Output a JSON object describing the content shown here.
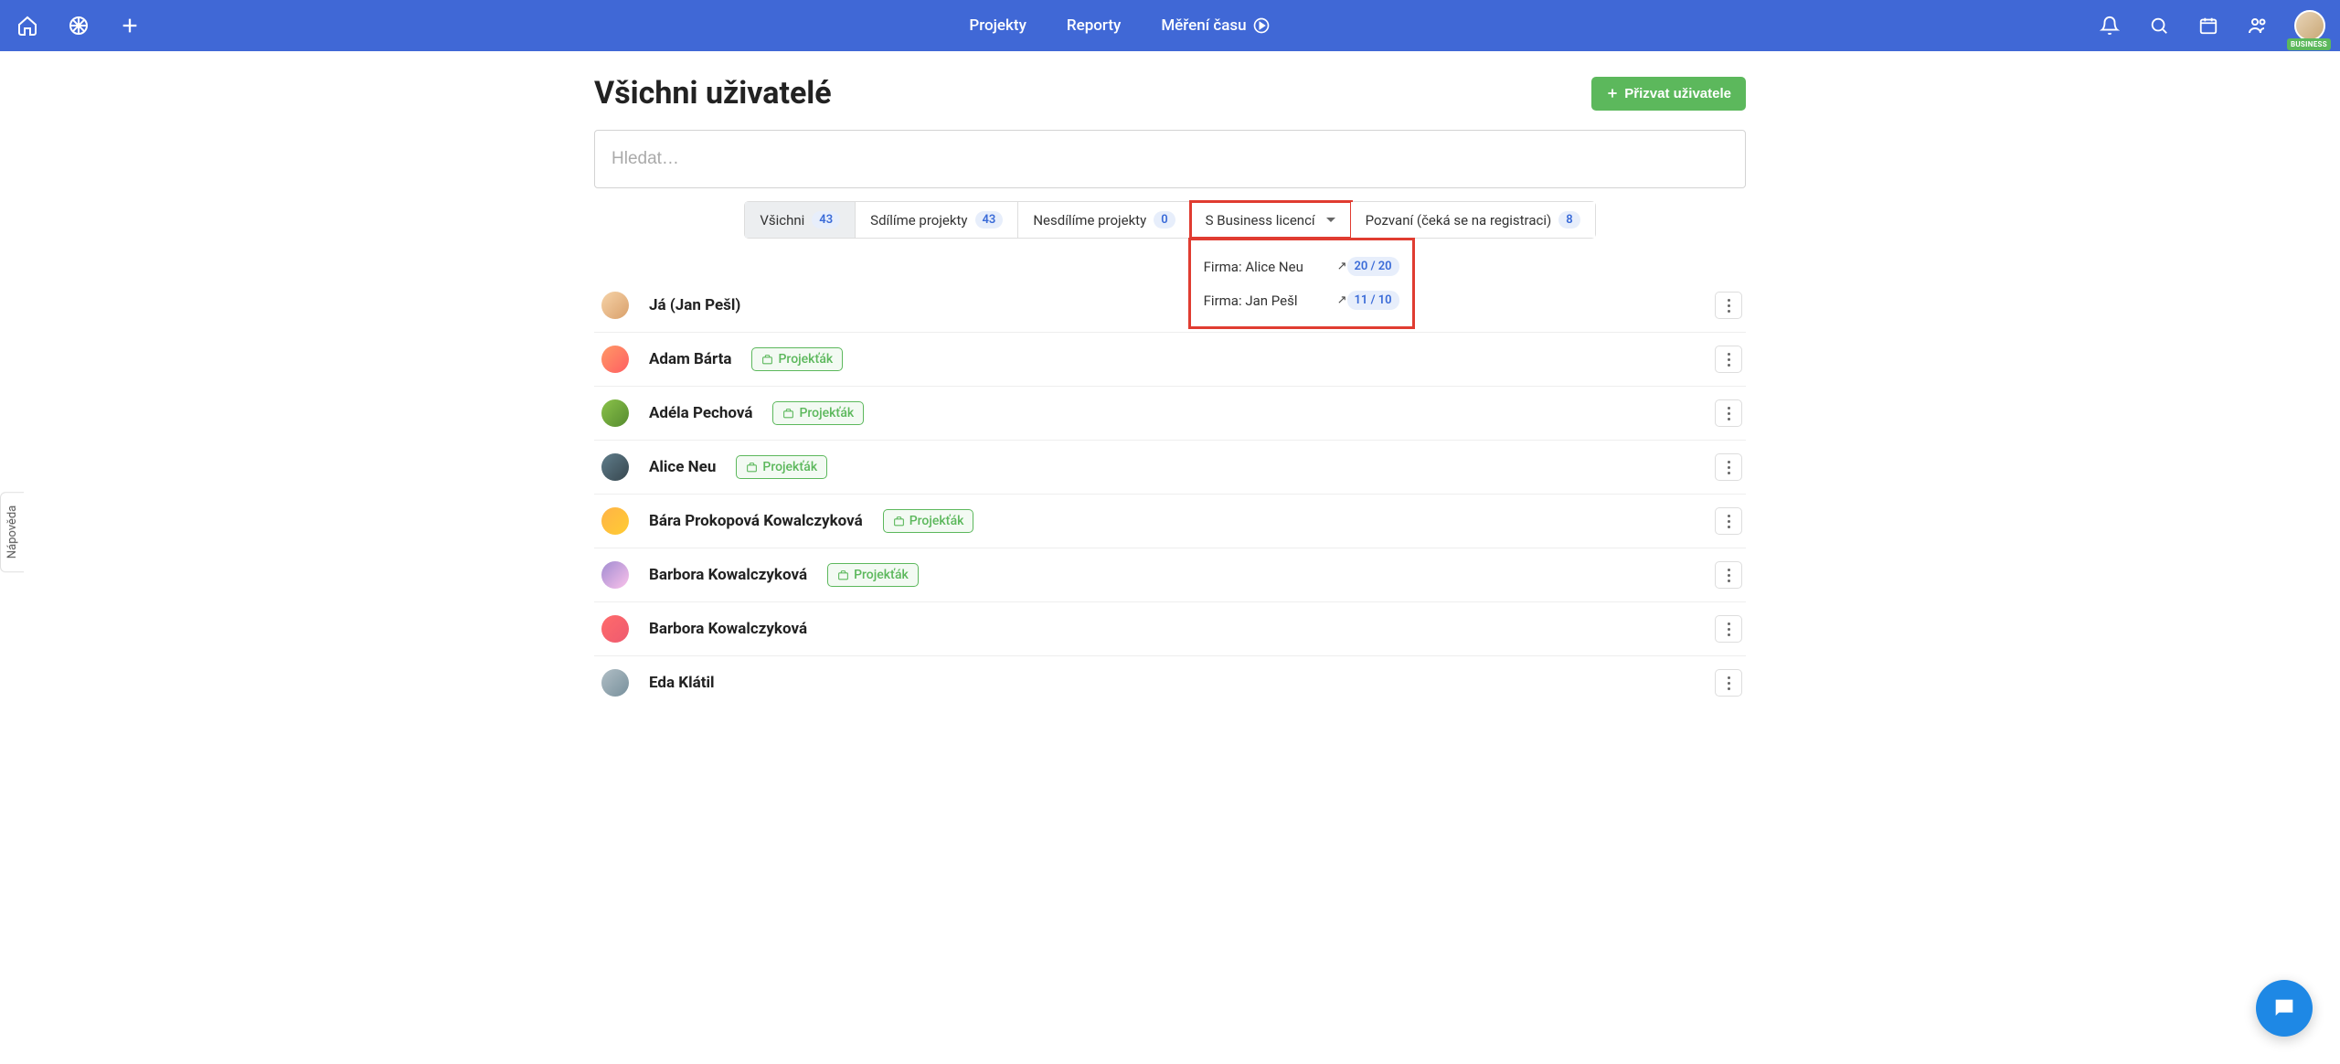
{
  "topbar": {
    "nav": {
      "projects": "Projekty",
      "reports": "Reporty",
      "timetracking": "Měření času"
    },
    "business_badge": "BUSINESS"
  },
  "help_tab": "Nápověda",
  "page": {
    "title": "Všichni uživatelé",
    "invite_button": "Přizvat uživatele",
    "search_placeholder": "Hledat…"
  },
  "filters": {
    "all": {
      "label": "Všichni",
      "count": "43"
    },
    "sharing": {
      "label": "Sdílíme projekty",
      "count": "43"
    },
    "not_sharing": {
      "label": "Nesdílíme projekty",
      "count": "0"
    },
    "business_license": {
      "label": "S Business licencí"
    },
    "invited": {
      "label": "Pozvaní (čeká se na registraci)",
      "count": "8"
    }
  },
  "license_dropdown": {
    "row1": {
      "label": "Firma: Alice Neu",
      "count": "20 / 20"
    },
    "row2": {
      "label": "Firma: Jan Pešl",
      "count": "11 / 10"
    }
  },
  "tags": {
    "projektak": "Projekťák"
  },
  "users": [
    {
      "name": "Já (Jan Pešl)",
      "tagged": false,
      "av": "av1"
    },
    {
      "name": "Adam Bárta",
      "tagged": true,
      "av": "av2"
    },
    {
      "name": "Adéla Pechová",
      "tagged": true,
      "av": "av3"
    },
    {
      "name": "Alice Neu",
      "tagged": true,
      "av": "av4"
    },
    {
      "name": "Bára Prokopová Kowalczyková",
      "tagged": true,
      "av": "av5"
    },
    {
      "name": "Barbora Kowalczyková",
      "tagged": true,
      "av": "av6"
    },
    {
      "name": "Barbora Kowalczyková",
      "tagged": false,
      "av": "av7"
    },
    {
      "name": "Eda Klátil",
      "tagged": false,
      "av": "av8"
    }
  ]
}
